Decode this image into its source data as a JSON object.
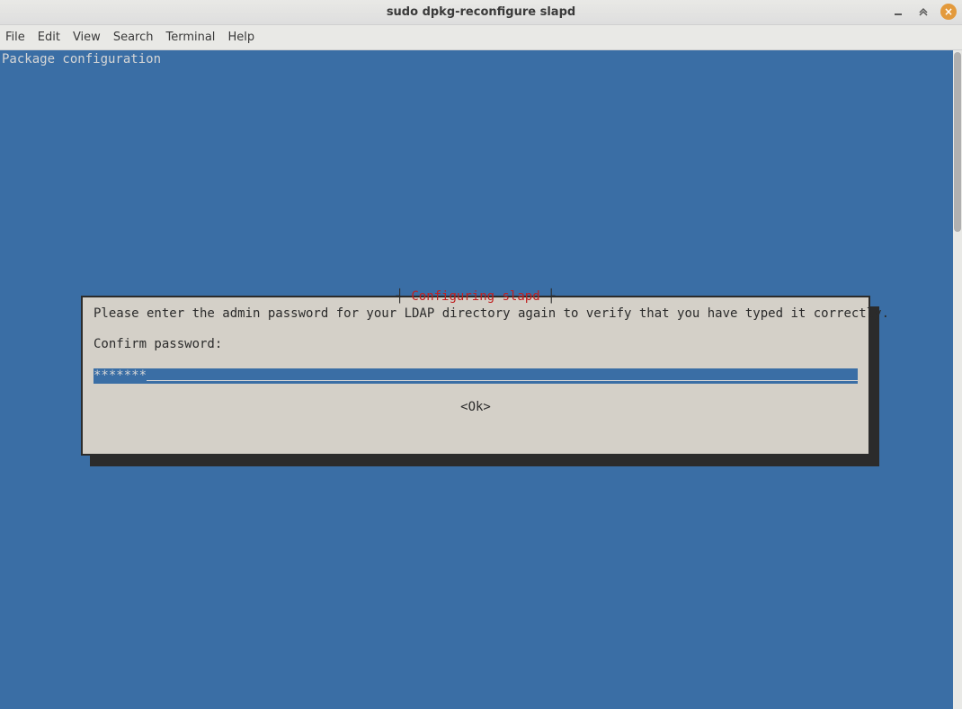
{
  "window": {
    "title": "sudo dpkg-reconfigure slapd"
  },
  "menubar": {
    "items": [
      "File",
      "Edit",
      "View",
      "Search",
      "Terminal",
      "Help"
    ]
  },
  "terminal": {
    "header": "Package configuration"
  },
  "dialog": {
    "title_text": "Configuring slapd",
    "line1": "Please enter the admin password for your LDAP directory again to verify that you have typed it correctly.",
    "line2": "Confirm password:",
    "password_value": "*******",
    "ok_label": "<Ok>"
  }
}
